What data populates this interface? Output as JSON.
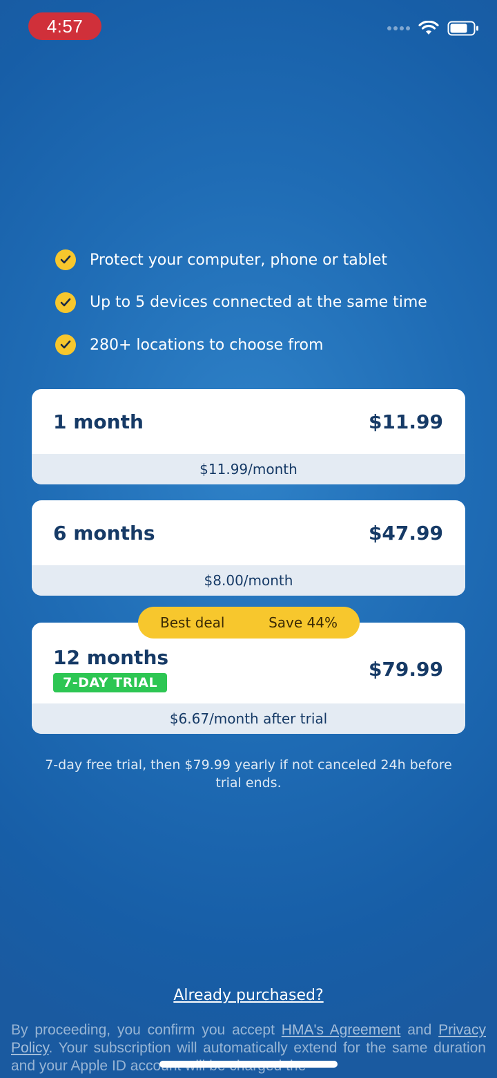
{
  "status_bar": {
    "time": "4:57"
  },
  "features": [
    {
      "text": "Protect your computer, phone or tablet"
    },
    {
      "text": "Up to 5 devices connected at the same time"
    },
    {
      "text": "280+ locations to choose from"
    }
  ],
  "plans": [
    {
      "name": "1 month",
      "price": "$11.99",
      "per_month": "$11.99/month"
    },
    {
      "name": "6 months",
      "price": "$47.99",
      "per_month": "$8.00/month"
    },
    {
      "name": "12 months",
      "price": "$79.99",
      "per_month": "$6.67/month after trial",
      "badge": "7-DAY TRIAL"
    }
  ],
  "deal": {
    "label": "Best deal",
    "save": "Save 44%"
  },
  "trial_note": "7-day free trial, then $79.99 yearly if not canceled 24h before trial ends.",
  "already_purchased": "Already purchased?",
  "legal": {
    "prefix": "By proceeding, you confirm you accept ",
    "agreement_link": "HMA's Agreement",
    "and": " and ",
    "privacy_link": "Privacy Policy",
    "suffix": ". Your subscription will automatically extend for the same duration and your Apple ID account will be charged the"
  },
  "colors": {
    "accent": "#f7c72d",
    "trial_green": "#2dc653",
    "text_dark": "#163a66"
  }
}
